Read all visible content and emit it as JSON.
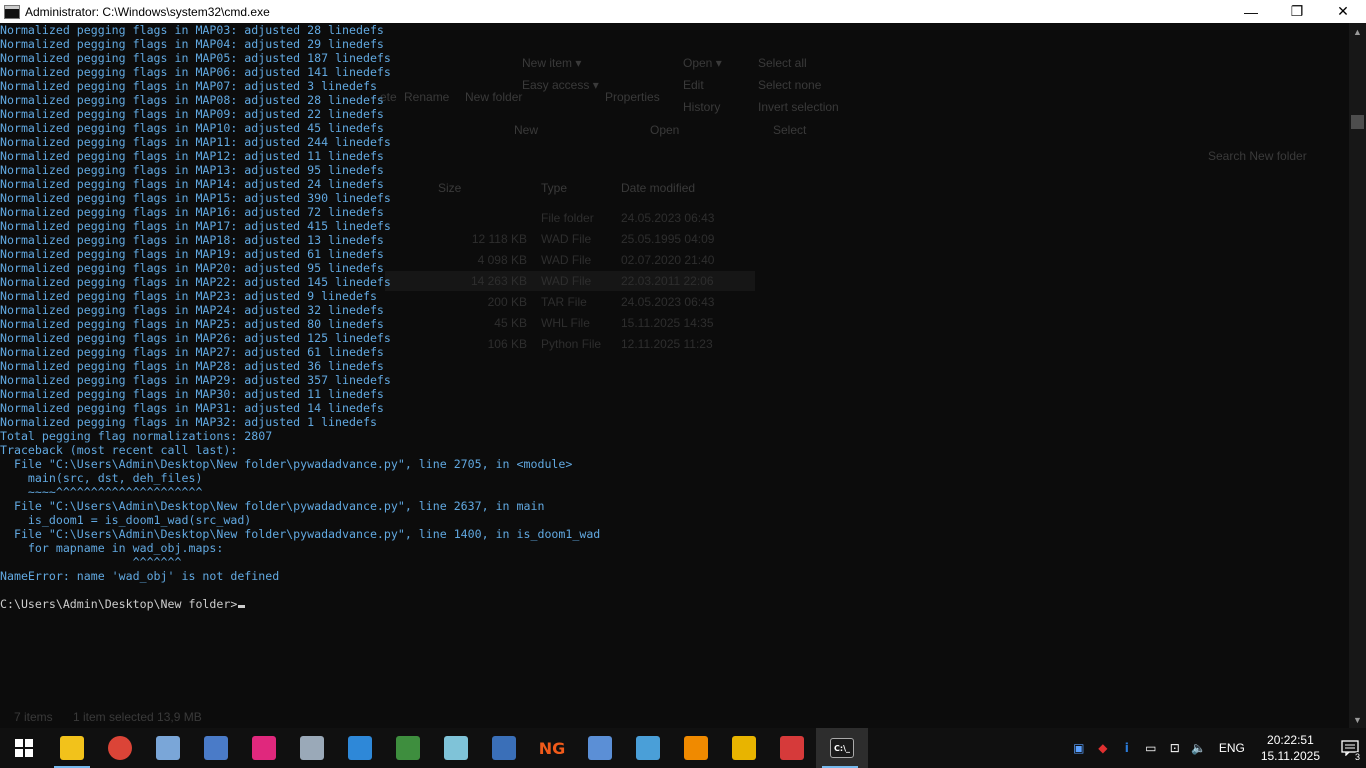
{
  "window": {
    "title": "Administrator: C:\\Windows\\system32\\cmd.exe",
    "minimize_glyph": "—",
    "maximize_glyph": "❐",
    "close_glyph": "✕"
  },
  "explorer_ghost": {
    "ribbon": [
      "New item ▾",
      "Easy access ▾",
      "Open ▾",
      "Edit",
      "History",
      "Select all",
      "Select none",
      "Invert selection",
      "Rename",
      "New folder",
      "Properties",
      "New",
      "Open",
      "Select",
      "ete"
    ],
    "search_placeholder": "Search New folder",
    "columns": [
      "Size",
      "Type",
      "Date modified"
    ],
    "rows": [
      {
        "size": "",
        "type": "File folder",
        "date": "24.05.2023 06:43"
      },
      {
        "size": "12 118 KB",
        "type": "WAD File",
        "date": "25.05.1995 04:09"
      },
      {
        "size": "4 098 KB",
        "type": "WAD File",
        "date": "02.07.2020 21:40"
      },
      {
        "size": "14 263 KB",
        "type": "WAD File",
        "date": "22.03.2011 22:06"
      },
      {
        "size": "200 KB",
        "type": "TAR File",
        "date": "24.05.2023 06:43"
      },
      {
        "size": "45 KB",
        "type": "WHL File",
        "date": "15.11.2025 14:35"
      },
      {
        "size": "106 KB",
        "type": "Python File",
        "date": "12.11.2025 11:23"
      }
    ],
    "status_items": "7 items",
    "status_selected": "1 item selected  13,9 MB"
  },
  "console": {
    "lines": [
      "Normalized pegging flags in MAP03: adjusted 28 linedefs",
      "Normalized pegging flags in MAP04: adjusted 29 linedefs",
      "Normalized pegging flags in MAP05: adjusted 187 linedefs",
      "Normalized pegging flags in MAP06: adjusted 141 linedefs",
      "Normalized pegging flags in MAP07: adjusted 3 linedefs",
      "Normalized pegging flags in MAP08: adjusted 28 linedefs",
      "Normalized pegging flags in MAP09: adjusted 22 linedefs",
      "Normalized pegging flags in MAP10: adjusted 45 linedefs",
      "Normalized pegging flags in MAP11: adjusted 244 linedefs",
      "Normalized pegging flags in MAP12: adjusted 11 linedefs",
      "Normalized pegging flags in MAP13: adjusted 95 linedefs",
      "Normalized pegging flags in MAP14: adjusted 24 linedefs",
      "Normalized pegging flags in MAP15: adjusted 390 linedefs",
      "Normalized pegging flags in MAP16: adjusted 72 linedefs",
      "Normalized pegging flags in MAP17: adjusted 415 linedefs",
      "Normalized pegging flags in MAP18: adjusted 13 linedefs",
      "Normalized pegging flags in MAP19: adjusted 61 linedefs",
      "Normalized pegging flags in MAP20: adjusted 95 linedefs",
      "Normalized pegging flags in MAP22: adjusted 145 linedefs",
      "Normalized pegging flags in MAP23: adjusted 9 linedefs",
      "Normalized pegging flags in MAP24: adjusted 32 linedefs",
      "Normalized pegging flags in MAP25: adjusted 80 linedefs",
      "Normalized pegging flags in MAP26: adjusted 125 linedefs",
      "Normalized pegging flags in MAP27: adjusted 61 linedefs",
      "Normalized pegging flags in MAP28: adjusted 36 linedefs",
      "Normalized pegging flags in MAP29: adjusted 357 linedefs",
      "Normalized pegging flags in MAP30: adjusted 11 linedefs",
      "Normalized pegging flags in MAP31: adjusted 14 linedefs",
      "Normalized pegging flags in MAP32: adjusted 1 linedefs",
      "Total pegging flag normalizations: 2807",
      "Traceback (most recent call last):",
      "  File \"C:\\Users\\Admin\\Desktop\\New folder\\pywadadvance.py\", line 2705, in <module>",
      "    main(src, dst, deh_files)",
      "    ~~~~^^^^^^^^^^^^^^^^^^^^^",
      "  File \"C:\\Users\\Admin\\Desktop\\New folder\\pywadadvance.py\", line 2637, in main",
      "    is_doom1 = is_doom1_wad(src_wad)",
      "  File \"C:\\Users\\Admin\\Desktop\\New folder\\pywadadvance.py\", line 1400, in is_doom1_wad",
      "    for mapname in wad_obj.maps:",
      "                   ^^^^^^^",
      "NameError: name 'wad_obj' is not defined",
      "",
      "C:\\Users\\Admin\\Desktop\\New folder>"
    ]
  },
  "taskbar": {
    "apps": [
      {
        "name": "file-explorer",
        "label": "",
        "color": "#f2c21b",
        "running": true
      },
      {
        "name": "chrome",
        "label": "",
        "color": "#db4437",
        "running": false
      },
      {
        "name": "paint-palette",
        "label": "",
        "color": "#7aa6d8",
        "running": false
      },
      {
        "name": "document-editor",
        "label": "",
        "color": "#4a7bc8",
        "running": false
      },
      {
        "name": "phone-app",
        "label": "",
        "color": "#e0287d",
        "running": false
      },
      {
        "name": "control-panel",
        "label": "",
        "color": "#9aa9b8",
        "running": false
      },
      {
        "name": "window-app",
        "label": "",
        "color": "#2e88d8",
        "running": false
      },
      {
        "name": "globe-tool",
        "label": "",
        "color": "#3e8e3e",
        "running": false
      },
      {
        "name": "notepad-app",
        "label": "",
        "color": "#7fc3d8",
        "running": false
      },
      {
        "name": "gear-app",
        "label": "",
        "color": "#3a6fb8",
        "running": false
      },
      {
        "name": "ng-app",
        "label": "NG",
        "color": "#f05a1a",
        "running": false
      },
      {
        "name": "monitor-app",
        "label": "",
        "color": "#5b8fd6",
        "running": false
      },
      {
        "name": "search-tool",
        "label": "",
        "color": "#4a9fd8",
        "running": false
      },
      {
        "name": "vlc",
        "label": "",
        "color": "#f08a00",
        "running": false
      },
      {
        "name": "lock-app",
        "label": "",
        "color": "#e8b400",
        "running": false
      },
      {
        "name": "game-app",
        "label": "",
        "color": "#d63a3a",
        "running": false
      },
      {
        "name": "cmd",
        "label": "C:\\_",
        "color": "#1a1a1a",
        "running": true
      }
    ],
    "tray_icons": [
      "▣",
      "◆",
      "i",
      "▭",
      "⊡",
      "🔈"
    ],
    "language": "ENG",
    "time": "20:22:51",
    "date": "15.11.2025",
    "notification_count": "3"
  }
}
